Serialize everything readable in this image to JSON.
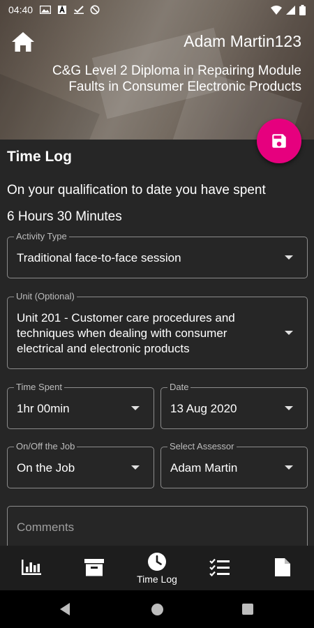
{
  "status_bar": {
    "time": "04:40",
    "icons": [
      "image-icon",
      "a-box-icon",
      "check-download-icon",
      "no-sync-icon"
    ],
    "right_icons": [
      "wifi-icon",
      "signal-icon",
      "battery-icon"
    ]
  },
  "header": {
    "user_name": "Adam Martin123",
    "course_title": "C&G Level 2 Diploma in Repairing Module Faults in Consumer Electronic Products"
  },
  "time_log": {
    "title": "Time Log",
    "summary_label": "On your qualification to date you have spent",
    "summary_total": "6 Hours 30 Minutes"
  },
  "form": {
    "activity_type": {
      "label": "Activity Type",
      "value": "Traditional face-to-face session"
    },
    "unit": {
      "label": "Unit (Optional)",
      "value": "Unit 201 - Customer care procedures and techniques when dealing with consumer electrical and electronic products"
    },
    "time_spent": {
      "label": "Time Spent",
      "value": "1hr 00min"
    },
    "date": {
      "label": "Date",
      "value": "13 Aug 2020"
    },
    "on_off_job": {
      "label": "On/Off the Job",
      "value": "On the Job"
    },
    "assessor": {
      "label": "Select Assessor",
      "value": "Adam Martin"
    },
    "comments": {
      "placeholder": "Comments"
    }
  },
  "bottom_nav": {
    "items": [
      {
        "icon": "bar-chart-icon",
        "label": ""
      },
      {
        "icon": "archive-icon",
        "label": ""
      },
      {
        "icon": "clock-icon",
        "label": "Time Log"
      },
      {
        "icon": "checklist-icon",
        "label": ""
      },
      {
        "icon": "document-icon",
        "label": ""
      }
    ]
  },
  "colors": {
    "accent": "#e6007e",
    "background": "#262626",
    "nav_background": "#1d1d1d"
  }
}
